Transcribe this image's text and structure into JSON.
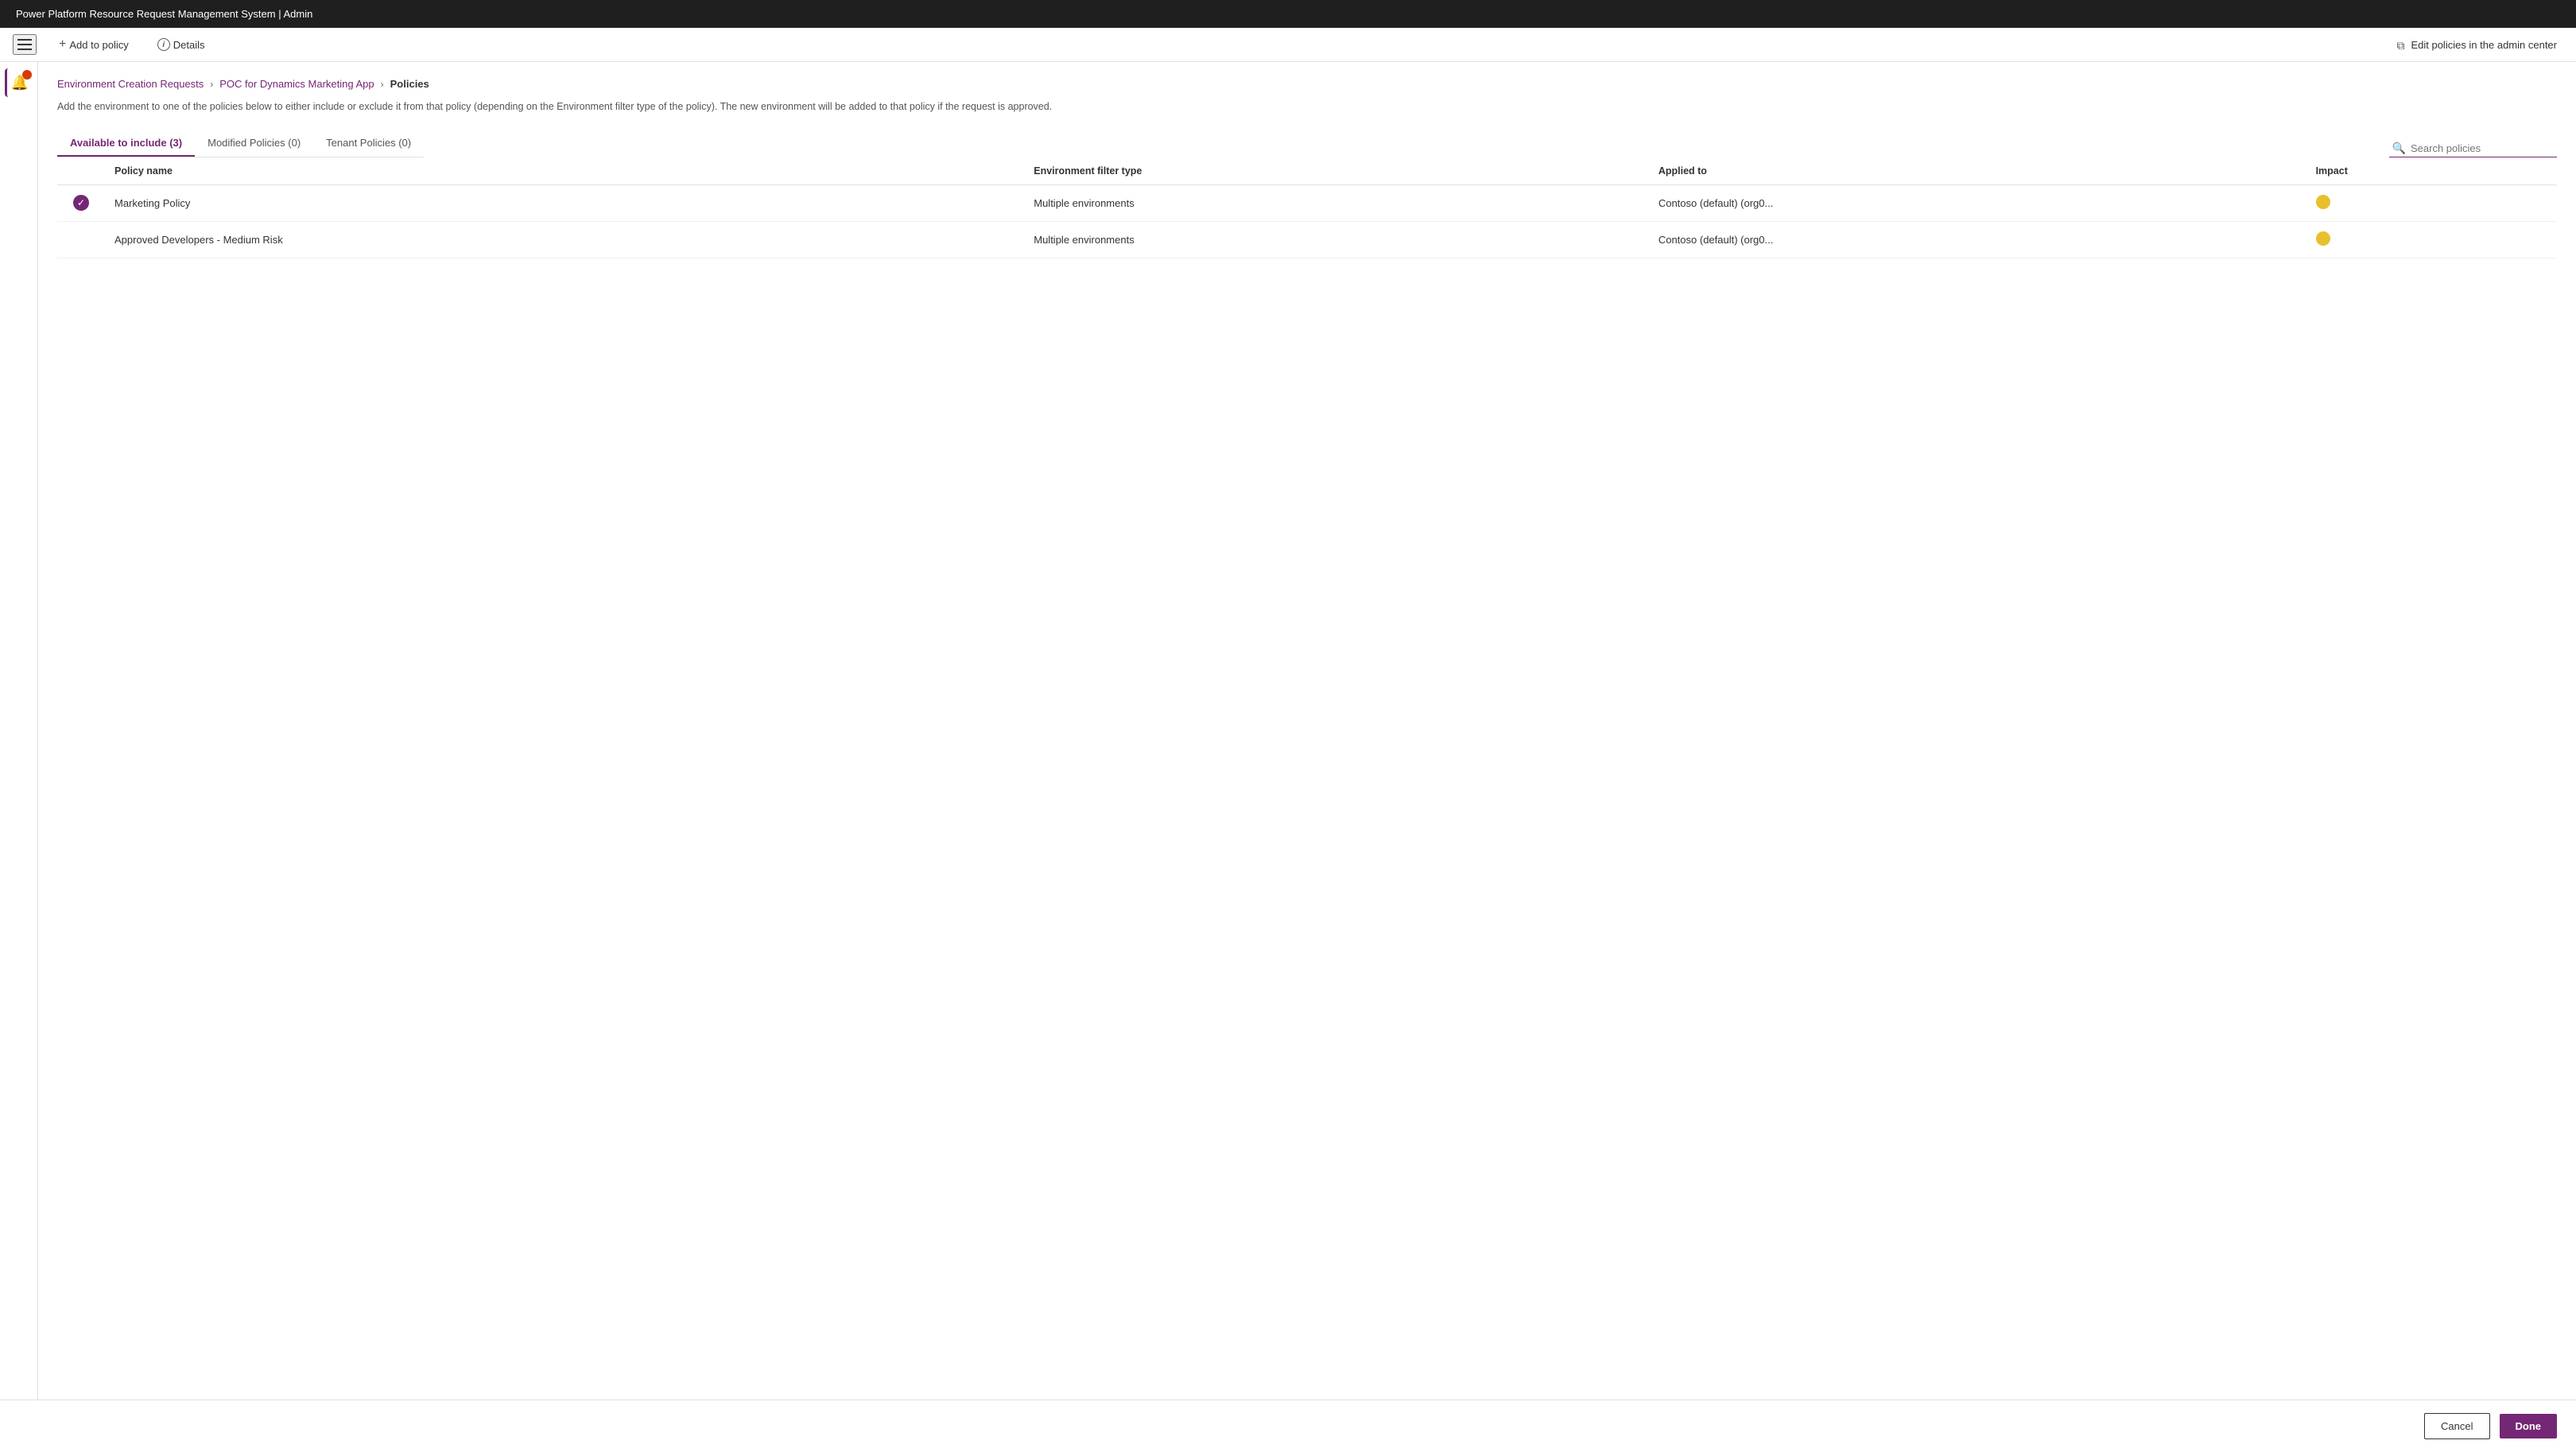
{
  "titleBar": {
    "text": "Power Platform Resource Request Management System | Admin"
  },
  "toolbar": {
    "addToPolicyLabel": "Add to policy",
    "detailsLabel": "Details",
    "editAdminLabel": "Edit policies in the admin center"
  },
  "breadcrumb": {
    "step1": "Environment Creation Requests",
    "step2": "POC for Dynamics Marketing App",
    "step3": "Policies"
  },
  "description": "Add the environment to one of the policies below to either include or exclude it from that policy (depending on the Environment filter type of the policy). The new environment will be added to that policy if the request is approved.",
  "tabs": [
    {
      "label": "Available to include (3)",
      "active": true
    },
    {
      "label": "Modified Policies (0)",
      "active": false
    },
    {
      "label": "Tenant Policies (0)",
      "active": false
    }
  ],
  "search": {
    "placeholder": "Search policies"
  },
  "table": {
    "columns": [
      {
        "id": "check",
        "label": ""
      },
      {
        "id": "policyName",
        "label": "Policy name"
      },
      {
        "id": "envFilterType",
        "label": "Environment filter type"
      },
      {
        "id": "appliedTo",
        "label": "Applied to"
      },
      {
        "id": "impact",
        "label": "Impact"
      }
    ],
    "rows": [
      {
        "selected": true,
        "policyName": "Marketing Policy",
        "envFilterType": "Multiple environments",
        "appliedTo": "Contoso (default) (org0...",
        "impact": "medium"
      },
      {
        "selected": false,
        "policyName": "Approved Developers - Medium Risk",
        "envFilterType": "Multiple environments",
        "appliedTo": "Contoso (default) (org0...",
        "impact": "medium"
      }
    ]
  },
  "footer": {
    "cancelLabel": "Cancel",
    "doneLabel": "Done"
  },
  "colors": {
    "accent": "#742774",
    "impactDot": "#e8c02c",
    "badge": "#d83b01"
  }
}
